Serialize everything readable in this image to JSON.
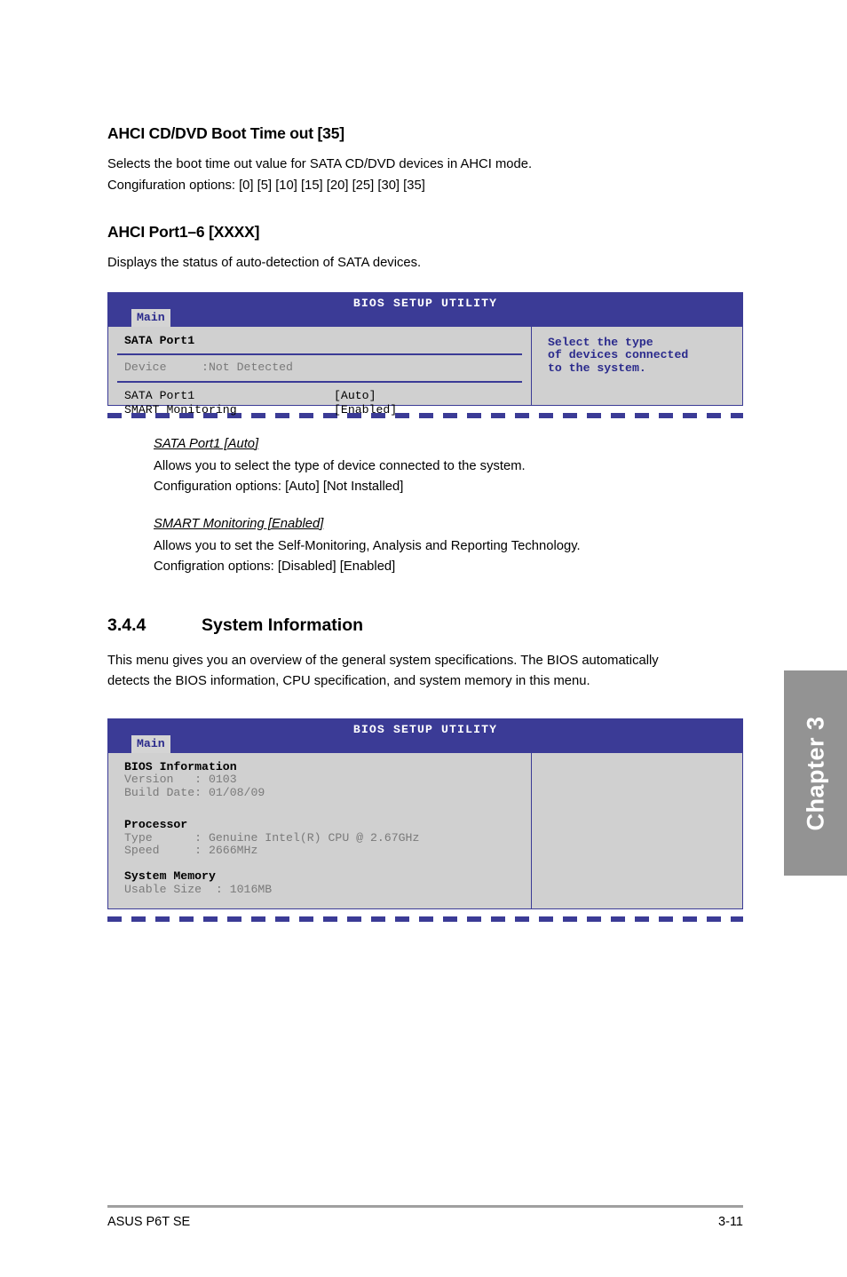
{
  "document": {
    "footer": {
      "left": "ASUS P6T SE",
      "right": "3-11"
    },
    "chapter_tab": "Chapter 3"
  },
  "sections": {
    "ahci_boot_timeout": {
      "heading": "AHCI CD/DVD Boot Time out [35]",
      "line1": "Selects the boot time out value for SATA CD/DVD devices in AHCI mode.",
      "line2": "Congifuration options: [0] [5] [10] [15] [20] [25] [30] [35]"
    },
    "ahci_port": {
      "heading": "AHCI Port1–6 [XXXX]",
      "line1": "Displays the status of auto-detection of SATA devices."
    },
    "sata_port1": {
      "title": "SATA Port1 [Auto]",
      "line1": "Allows you to select the type of device connected to the system.",
      "line2": "Configuration options: [Auto] [Not Installed]"
    },
    "smart_monitoring": {
      "title": "SMART Monitoring [Enabled]",
      "line1": "Allows you to set the Self-Monitoring, Analysis and Reporting Technology.",
      "line2": "Configration options: [Disabled] [Enabled]"
    },
    "system_information": {
      "number": "3.4.4",
      "heading": "System Information",
      "line1": "This menu gives you an overview of the general system specifications. The BIOS automatically",
      "line2": "detects the BIOS information, CPU specification, and system memory in this menu."
    }
  },
  "bios_screen_1": {
    "title": "BIOS SETUP UTILITY",
    "tab": "Main",
    "section_heading": "SATA Port1",
    "device_row": "Device     :Not Detected",
    "settings": [
      {
        "label": "SATA Port1",
        "value": "[Auto]"
      },
      {
        "label": "SMART Monitoring",
        "value": "[Enabled]"
      }
    ],
    "help": [
      "Select the type",
      "of devices connected",
      "to the system."
    ]
  },
  "bios_screen_2": {
    "title": "BIOS SETUP UTILITY",
    "tab": "Main",
    "groups": [
      {
        "heading": "BIOS Information",
        "rows": [
          "Version   : 0103",
          "Build Date: 01/08/09"
        ]
      },
      {
        "heading": "Processor",
        "rows": [
          "Type      : Genuine Intel(R) CPU @ 2.67GHz",
          "Speed     : 2666MHz"
        ]
      },
      {
        "heading": "System Memory",
        "rows": [
          "Usable Size  : 1016MB"
        ]
      }
    ],
    "help": []
  },
  "colors": {
    "bios_header_blue": "#3b3b96",
    "bios_text_blue": "#2a2a8c",
    "bios_body_gray": "#d0d0d0",
    "bios_gray_text": "#7a7a7a",
    "chapter_tab_gray": "#939393"
  }
}
